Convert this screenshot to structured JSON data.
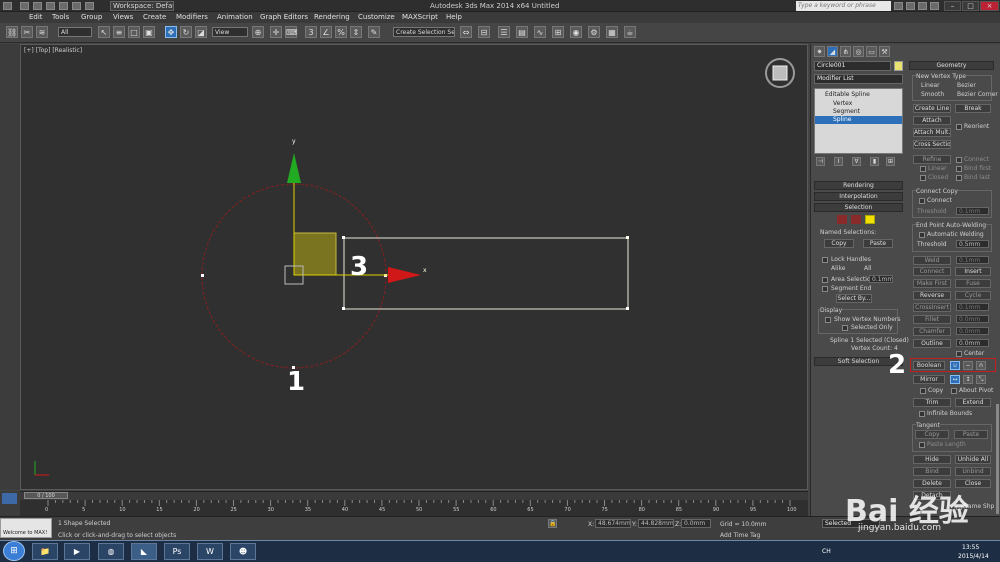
{
  "titlebar": {
    "workspace": "Workspace: Default",
    "title": "Autodesk 3ds Max  2014 x64      Untitled",
    "search_placeholder": "Type a keyword or phrase",
    "min": "–",
    "max": "□",
    "close": "×"
  },
  "menu": [
    "Edit",
    "Tools",
    "Group",
    "Views",
    "Create",
    "Modifiers",
    "Animation",
    "Graph Editors",
    "Rendering",
    "Customize",
    "MAXScript",
    "Help"
  ],
  "toolbar": {
    "filter": "All",
    "refcoord": "View",
    "selection_set": "Create Selection Se"
  },
  "viewport": {
    "label": "[+] [Top] [Realistic]",
    "gizmo_y": "y",
    "gizmo_x": "x",
    "annot_1": "1",
    "annot_2": "2",
    "annot_3": "3"
  },
  "panel": {
    "object_name": "Circle001",
    "modifier_list": "Modifier List",
    "stack": [
      "Editable Spline",
      "Vertex",
      "Segment",
      "Spline"
    ],
    "rollouts": {
      "rendering": "Rendering",
      "interpolation": "Interpolation",
      "selection": "Selection",
      "soft_selection": "Soft Selection",
      "geometry": "Geometry"
    },
    "selection": {
      "named_selections": "Named Selections:",
      "copy": "Copy",
      "paste": "Paste",
      "lock_handles": "Lock Handles",
      "alike": "Alike",
      "all": "All",
      "area_selection": "Area Selection:",
      "area_value": "0.1mm",
      "segment_end": "Segment End",
      "select_by": "Select By...",
      "display": "Display",
      "show_vertex_numbers": "Show Vertex Numbers",
      "selected_only": "Selected Only",
      "status1": "Spline 1 Selected (Closed)",
      "status2": "Vertex Count: 4"
    },
    "geometry": {
      "new_vertex_type": "New Vertex Type",
      "linear": "Linear",
      "bezier": "Bezier",
      "smooth": "Smooth",
      "bezier_corner": "Bezier Corner",
      "create_line": "Create Line",
      "break": "Break",
      "attach": "Attach",
      "reorient": "Reorient",
      "attach_mult": "Attach Mult.",
      "cross_section": "Cross Section",
      "refine": "Refine",
      "connect": "Connect",
      "linear2": "Linear",
      "bind_first": "Bind first",
      "closed": "Closed",
      "bind_last": "Bind last",
      "connect_copy": "Connect Copy",
      "connect2": "Connect",
      "threshold": "Threshold",
      "threshold_val": "0.1mm",
      "end_point_welding": "End Point Auto-Welding",
      "automatic_welding": "Automatic Welding",
      "threshold2": "Threshold",
      "threshold2_val": "0.5mm",
      "weld": "Weld",
      "weld_val": "0.1mm",
      "connect3": "Connect",
      "insert": "Insert",
      "make_first": "Make First",
      "fuse": "Fuse",
      "reverse": "Reverse",
      "cycle": "Cycle",
      "crossinsert": "CrossInsert",
      "crossinsert_val": "0.1mm",
      "fillet": "Fillet",
      "fillet_val": "0.0mm",
      "chamfer": "Chamfer",
      "chamfer_val": "0.0mm",
      "outline": "Outline",
      "outline_val": "0.0mm",
      "center": "Center",
      "boolean": "Boolean",
      "mirror": "Mirror",
      "copy": "Copy",
      "about_pivot": "About Pivot",
      "trim": "Trim",
      "extend": "Extend",
      "infinite_bounds": "Infinite Bounds",
      "tangent": "Tangent",
      "copy2": "Copy",
      "paste2": "Paste",
      "paste_length": "Paste Length",
      "hide": "Hide",
      "unhide_all": "Unhide All",
      "bind": "Bind",
      "unbind": "Unbind",
      "delete": "Delete",
      "close": "Close",
      "detach": "Detach",
      "same_shp": "Same Shp"
    }
  },
  "timeline": {
    "frame": "0 / 100",
    "ticks": [
      "0",
      "5",
      "10",
      "15",
      "20",
      "25",
      "30",
      "35",
      "40",
      "45",
      "50",
      "55",
      "60",
      "65",
      "70",
      "75",
      "80",
      "85",
      "90",
      "95",
      "100"
    ]
  },
  "status": {
    "listener": "Welcome to MAX!",
    "line1": "1 Shape Selected",
    "line2": "Click or click-and-drag to select objects",
    "x_label": "X:",
    "x_val": "48.674mm",
    "y_label": "Y:",
    "y_val": "44.828mm",
    "z_label": "Z:",
    "z_val": "0.0mm",
    "grid": "Grid = 10.0mm",
    "add_time_tag": "Add Time Tag",
    "auto_key": "Selected",
    "set_key": "Key Filters..."
  },
  "taskbar": {
    "ch": "CH",
    "time": "13:55",
    "date": "2015/4/14"
  },
  "watermark": {
    "text": "Bai 经验",
    "url": "jingyan.baidu.com"
  },
  "colors": {
    "accent": "#2d6fb8",
    "spline_circle": "#8a1f1f",
    "rectangle": "#e8e8d8",
    "gizmo_y": "#22aa22",
    "gizmo_x": "#d01818",
    "highlight_box": "#c02020"
  }
}
